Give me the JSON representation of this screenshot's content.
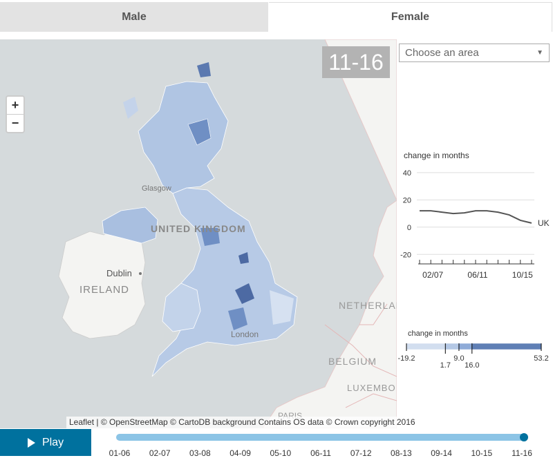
{
  "tabs": {
    "male": "Male",
    "female": "Female"
  },
  "map": {
    "period": "11-16",
    "zoom_in": "+",
    "zoom_out": "−",
    "place_labels": {
      "united_kingdom": "UNITED KINGDOM",
      "ireland": "IRELAND",
      "dublin": "Dublin",
      "netherlands": "NETHERLAN",
      "belgium": "BELGIUM",
      "luxembourg": "LUXEMBO",
      "paris": "PARIS",
      "glasgow": "Glasgow",
      "london": "London"
    },
    "attribution": "Leaflet | © OpenStreetMap © CartoDB background Contains OS data © Crown copyright 2016"
  },
  "area_select": {
    "placeholder": "Choose an area",
    "arrow": "▼"
  },
  "line_chart": {
    "title": "change in months",
    "series_label": "UK",
    "y_ticks": [
      "40",
      "20",
      "0",
      "-20"
    ],
    "x_ticks": [
      "02/07",
      "06/11",
      "10/15"
    ]
  },
  "legend": {
    "title": "change in months",
    "thresholds": [
      "-19.2",
      "1.7",
      "9.0",
      "16.0",
      "53.2"
    ],
    "colors": [
      "#d2deef",
      "#b4c8e5",
      "#8fabd8",
      "#5f7fb5"
    ]
  },
  "controls": {
    "play_label": "Play",
    "periods": [
      "01-06",
      "02-07",
      "03-08",
      "04-09",
      "05-10",
      "06-11",
      "07-12",
      "08-13",
      "09-14",
      "10-15",
      "11-16"
    ]
  },
  "chart_data": {
    "type": "line",
    "x": [
      "01/06",
      "02/07",
      "03/08",
      "04/09",
      "05/10",
      "06/11",
      "07/12",
      "08/13",
      "09/14",
      "10/15",
      "11/16"
    ],
    "series": [
      {
        "name": "UK",
        "values": [
          12,
          12,
          11,
          10,
          10.5,
          12,
          12,
          11,
          9,
          5,
          3
        ]
      }
    ],
    "ylabel": "change in months",
    "ylim": [
      -30,
      45
    ]
  },
  "colors": {
    "tab_active_bg": "#e3e3e3",
    "play_bg": "#00719e",
    "slider": "#8cc4e6",
    "sea": "#d5dadc",
    "land": "#f4f4f2"
  }
}
